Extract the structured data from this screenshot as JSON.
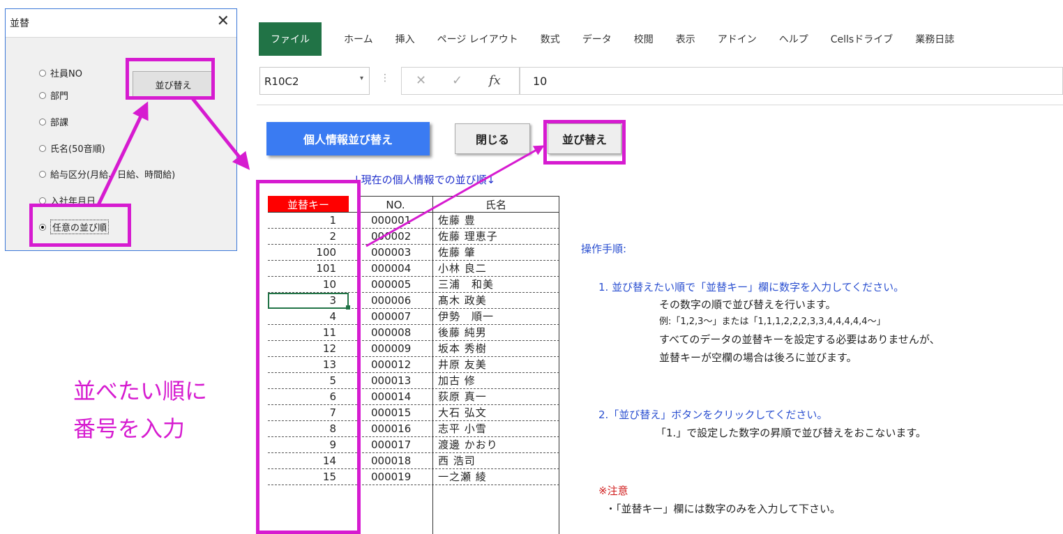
{
  "dialog": {
    "title": "並替",
    "close_glyph": "✕",
    "sort_button": "並び替え",
    "options": [
      {
        "label": "社員NO",
        "selected": false
      },
      {
        "label": "部門",
        "selected": false
      },
      {
        "label": "部課",
        "selected": false
      },
      {
        "label": "氏名(50音順)",
        "selected": false
      },
      {
        "label": "給与区分(月給、日給、時間給)",
        "selected": false
      },
      {
        "label": "入社年月日",
        "selected": false
      },
      {
        "label": "任意の並び順",
        "selected": true
      }
    ]
  },
  "ribbon": {
    "tabs": [
      "ファイル",
      "ホーム",
      "挿入",
      "ページ レイアウト",
      "数式",
      "データ",
      "校閲",
      "表示",
      "アドイン",
      "ヘルプ",
      "Cellsドライブ",
      "業務日誌"
    ]
  },
  "formula_bar": {
    "name_box": "R10C2",
    "cancel_glyph": "✕",
    "enter_glyph": "✓",
    "fx": "fx",
    "value": "10"
  },
  "sheet": {
    "buttons": {
      "personal_sort": "個人情報並び替え",
      "close": "閉じる",
      "sort": "並び替え"
    },
    "list_caption": "↓現在の個人情報での並び順↓",
    "table": {
      "headers": [
        "並替キー",
        "NO.",
        "氏名"
      ],
      "rows": [
        {
          "key": "1",
          "no": "000001",
          "name": "佐藤 豊"
        },
        {
          "key": "2",
          "no": "000002",
          "name": "佐藤 理恵子"
        },
        {
          "key": "100",
          "no": "000003",
          "name": "佐藤 肇"
        },
        {
          "key": "101",
          "no": "000004",
          "name": "小林 良二"
        },
        {
          "key": "10",
          "no": "000005",
          "name": "三浦　和美"
        },
        {
          "key": "3",
          "no": "000006",
          "name": "髙木 政美"
        },
        {
          "key": "4",
          "no": "000007",
          "name": "伊勢　順一"
        },
        {
          "key": "11",
          "no": "000008",
          "name": "後藤 純男"
        },
        {
          "key": "12",
          "no": "000009",
          "name": "坂本 秀樹"
        },
        {
          "key": "13",
          "no": "000012",
          "name": "井原 友美"
        },
        {
          "key": "5",
          "no": "000013",
          "name": "加古 修"
        },
        {
          "key": "6",
          "no": "000014",
          "name": "荻原 真一"
        },
        {
          "key": "7",
          "no": "000015",
          "name": "大石 弘文"
        },
        {
          "key": "8",
          "no": "000016",
          "name": "志平 小雪"
        },
        {
          "key": "9",
          "no": "000017",
          "name": "渡邊 かおり"
        },
        {
          "key": "14",
          "no": "000018",
          "name": "西 浩司"
        },
        {
          "key": "15",
          "no": "000019",
          "name": "一之瀬 綾"
        }
      ]
    },
    "instructions": {
      "heading": "操作手順:",
      "step1": "1. 並び替えたい順で「並替キー」欄に数字を入力してください。",
      "step1_lines": [
        "その数字の順で並び替えを行います。",
        "例:「1,2,3〜」または「1,1,1,2,2,2,3,3,4,4,4,4,4〜」",
        "すべてのデータの並替キーを設定する必要はありませんが、",
        "並替キーが空欄の場合は後ろに並びます。"
      ],
      "step2": "2.「並び替え」ボタンをクリックしてください。",
      "step2_line": "「1.」で設定した数字の昇順で並び替えをおこないます。",
      "note_heading": "※注意",
      "note_line": "・「並替キー」欄には数字のみを入力して下さい。"
    }
  },
  "annotation": {
    "line1": "並べたい順に",
    "line2": "番号を入力",
    "color": "#d61bd0"
  }
}
